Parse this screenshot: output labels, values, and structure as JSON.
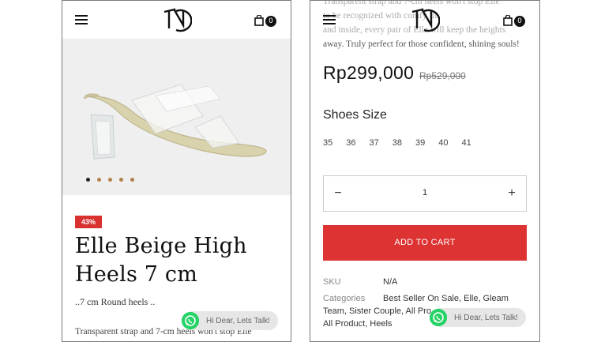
{
  "left": {
    "cart_count": "0",
    "discount_badge": "43%",
    "product_title": "Elle Beige High Heels 7 cm",
    "subtitle": "..7 cm Round heels ..",
    "description_preview": "Transparent strap and 7-cm heels won't stop Elle",
    "gallery_dots": 5,
    "whatsapp_label": "Hi Dear, Lets Talk!"
  },
  "right": {
    "cart_count": "0",
    "description_line1": "Transparent strap and 7-cm heels won't stop Elle",
    "description_line2": "to be recognized with comfy fit",
    "description_line3": "and inside, every pair of Elle will keep the heights",
    "description_line4": "away. Truly perfect for those confident, shining souls!",
    "price": "Rp299,000",
    "old_price": "Rp529,000",
    "size_label": "Shoes Size",
    "sizes": [
      "35",
      "36",
      "37",
      "38",
      "39",
      "40",
      "41"
    ],
    "quantity": "1",
    "minus": "−",
    "plus": "+",
    "add_to_cart": "ADD TO CART",
    "sku_label": "SKU",
    "sku_value": "N/A",
    "categories_label": "Categories",
    "categories_line1": "Best Seller On Sale, Elle, Gleam",
    "categories_line2": "Team, Sister Couple, All Pro",
    "categories_line3": "All Product, Heels",
    "whatsapp_label": "Hi Dear, Lets Talk!"
  },
  "colors": {
    "accent_red": "#dd3333",
    "badge_red": "#d9312f",
    "whatsapp_green": "#25d366",
    "dot_brown": "#b0804a"
  }
}
